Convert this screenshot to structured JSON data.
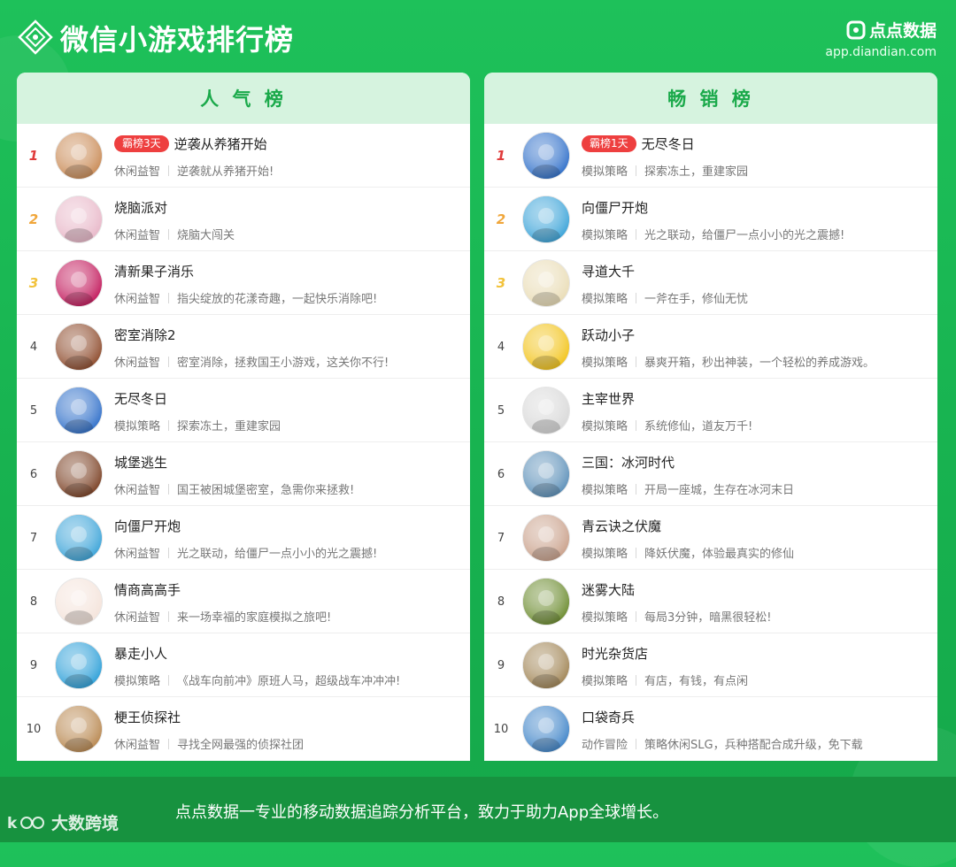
{
  "header": {
    "title": "微信小游戏排行榜",
    "brand_name": "点点数据",
    "brand_url": "app.diandian.com"
  },
  "popular": {
    "heading": "人 气 榜",
    "items": [
      {
        "rank": "1",
        "badge": "霸榜3天",
        "name": "逆袭从养猪开始",
        "category": "休闲益智",
        "desc": "逆袭就从养猪开始!",
        "icon": "pig-farm-game-icon",
        "color": "#c98a55"
      },
      {
        "rank": "2",
        "badge": "",
        "name": "烧脑派对",
        "category": "休闲益智",
        "desc": "烧脑大闯关",
        "icon": "brain-party-game-icon",
        "color": "#e8b7c8"
      },
      {
        "rank": "3",
        "badge": "",
        "name": "清新果子消乐",
        "category": "休闲益智",
        "desc": "指尖绽放的花漾奇趣，一起快乐消除吧!",
        "icon": "fruit-match-game-icon",
        "color": "#c2185b"
      },
      {
        "rank": "4",
        "badge": "",
        "name": "密室消除2",
        "category": "休闲益智",
        "desc": "密室消除，拯救国王小游戏，这关你不行!",
        "icon": "escape-room-game-icon",
        "color": "#8d4a2b"
      },
      {
        "rank": "5",
        "badge": "",
        "name": "无尽冬日",
        "category": "模拟策略",
        "desc": "探索冻土，重建家园",
        "icon": "endless-winter-game-icon",
        "color": "#2f6fc9"
      },
      {
        "rank": "6",
        "badge": "",
        "name": "城堡逃生",
        "category": "休闲益智",
        "desc": "国王被困城堡密室，急需你来拯救!",
        "icon": "castle-escape-game-icon",
        "color": "#7a3f22"
      },
      {
        "rank": "7",
        "badge": "",
        "name": "向僵尸开炮",
        "category": "休闲益智",
        "desc": "光之联动，给僵尸一点小小的光之震撼!",
        "icon": "zombie-cannon-game-icon",
        "color": "#3aa3d8"
      },
      {
        "rank": "8",
        "badge": "",
        "name": "情商高高手",
        "category": "休闲益智",
        "desc": "来一场幸福的家庭模拟之旅吧!",
        "icon": "eq-master-game-icon",
        "color": "#f4e3da"
      },
      {
        "rank": "9",
        "badge": "",
        "name": "暴走小人",
        "category": "模拟策略",
        "desc": "《战车向前冲》原班人马，超级战车冲冲冲!",
        "icon": "rampage-runner-game-icon",
        "color": "#2c9fd8"
      },
      {
        "rank": "10",
        "badge": "",
        "name": "梗王侦探社",
        "category": "休闲益智",
        "desc": "寻找全网最强的侦探社团",
        "icon": "meme-detective-game-icon",
        "color": "#b8874f"
      }
    ]
  },
  "bestseller": {
    "heading": "畅 销 榜",
    "items": [
      {
        "rank": "1",
        "badge": "霸榜1天",
        "name": "无尽冬日",
        "category": "模拟策略",
        "desc": "探索冻土，重建家园",
        "icon": "endless-winter-game-icon",
        "color": "#2f6fc9"
      },
      {
        "rank": "2",
        "badge": "",
        "name": "向僵尸开炮",
        "category": "模拟策略",
        "desc": "光之联动，给僵尸一点小小的光之震撼!",
        "icon": "zombie-cannon-game-icon",
        "color": "#3aa3d8"
      },
      {
        "rank": "3",
        "badge": "",
        "name": "寻道大千",
        "category": "模拟策略",
        "desc": "一斧在手，修仙无忧",
        "icon": "dao-journey-game-icon",
        "color": "#e9dcb5"
      },
      {
        "rank": "4",
        "badge": "",
        "name": "跃动小子",
        "category": "模拟策略",
        "desc": "暴爽开箱，秒出神装，一个轻松的养成游戏。",
        "icon": "leaping-kid-game-icon",
        "color": "#f2c318"
      },
      {
        "rank": "5",
        "badge": "",
        "name": "主宰世界",
        "category": "模拟策略",
        "desc": "系统修仙，道友万千!",
        "icon": "rule-world-game-icon",
        "color": "#d8d8d8"
      },
      {
        "rank": "6",
        "badge": "",
        "name": "三国：冰河时代",
        "category": "模拟策略",
        "desc": "开局一座城，生存在冰河末日",
        "icon": "three-kingdoms-ice-game-icon",
        "color": "#5b8fb8"
      },
      {
        "rank": "7",
        "badge": "",
        "name": "青云诀之伏魔",
        "category": "模拟策略",
        "desc": "降妖伏魔，体验最真实的修仙",
        "icon": "qingyun-game-icon",
        "color": "#c9a08a"
      },
      {
        "rank": "8",
        "badge": "",
        "name": "迷雾大陆",
        "category": "模拟策略",
        "desc": "每局3分钟，暗黑很轻松!",
        "icon": "misty-continent-game-icon",
        "color": "#6b8b2e"
      },
      {
        "rank": "9",
        "badge": "",
        "name": "时光杂货店",
        "category": "模拟策略",
        "desc": "有店，有钱，有点闲",
        "icon": "time-store-game-icon",
        "color": "#a08454"
      },
      {
        "rank": "10",
        "badge": "",
        "name": "口袋奇兵",
        "category": "动作冒险",
        "desc": "策略休闲SLG，兵种搭配合成升级，免下载",
        "icon": "pocket-soldier-game-icon",
        "color": "#3f84c8"
      }
    ]
  },
  "footer": {
    "tagline": "点点数据一专业的移动数据追踪分析平台，致力于助力App全球增长。",
    "watermark": "大数跨境"
  }
}
